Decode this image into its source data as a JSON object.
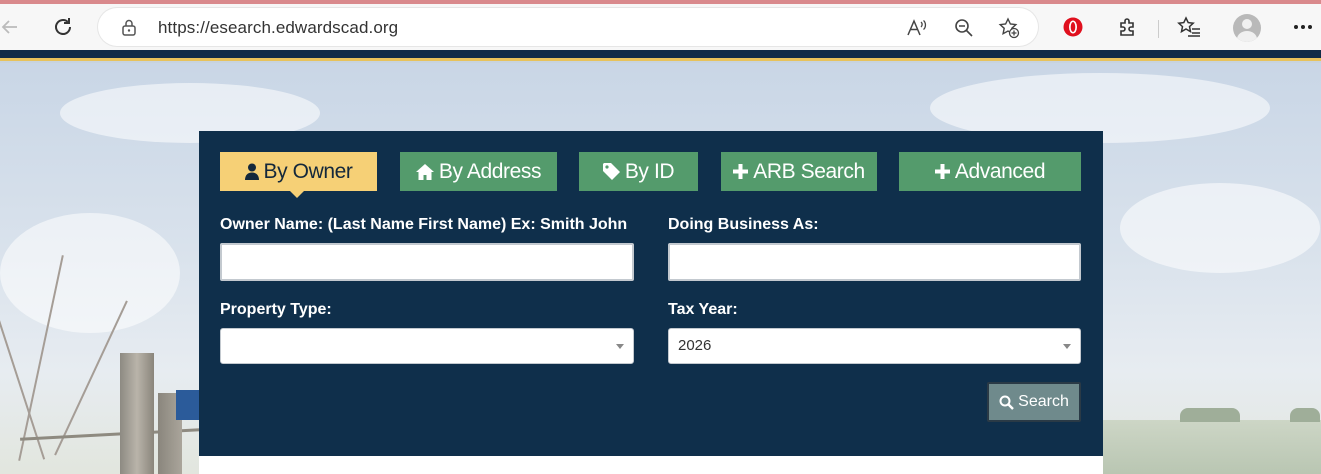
{
  "browser": {
    "url": "https://esearch.edwardscad.org"
  },
  "tabs": [
    {
      "label": "By Owner",
      "icon": "user-icon",
      "active": true
    },
    {
      "label": "By Address",
      "icon": "home-icon",
      "active": false
    },
    {
      "label": "By ID",
      "icon": "tag-icon",
      "active": false
    },
    {
      "label": "ARB Search",
      "icon": "plus-icon",
      "active": false
    },
    {
      "label": "Advanced",
      "icon": "plus-icon",
      "active": false
    }
  ],
  "form": {
    "owner_name_label": "Owner Name: (Last Name First Name) Ex: Smith John",
    "owner_name_value": "",
    "dba_label": "Doing Business As:",
    "dba_value": "",
    "property_type_label": "Property Type:",
    "property_type_value": "",
    "tax_year_label": "Tax Year:",
    "tax_year_value": "2026",
    "search_label": "Search"
  },
  "colors": {
    "panel": "#0f2f4b",
    "tab": "#549b6c",
    "tab_active": "#f6d076",
    "search_button": "#6f8a8c"
  }
}
